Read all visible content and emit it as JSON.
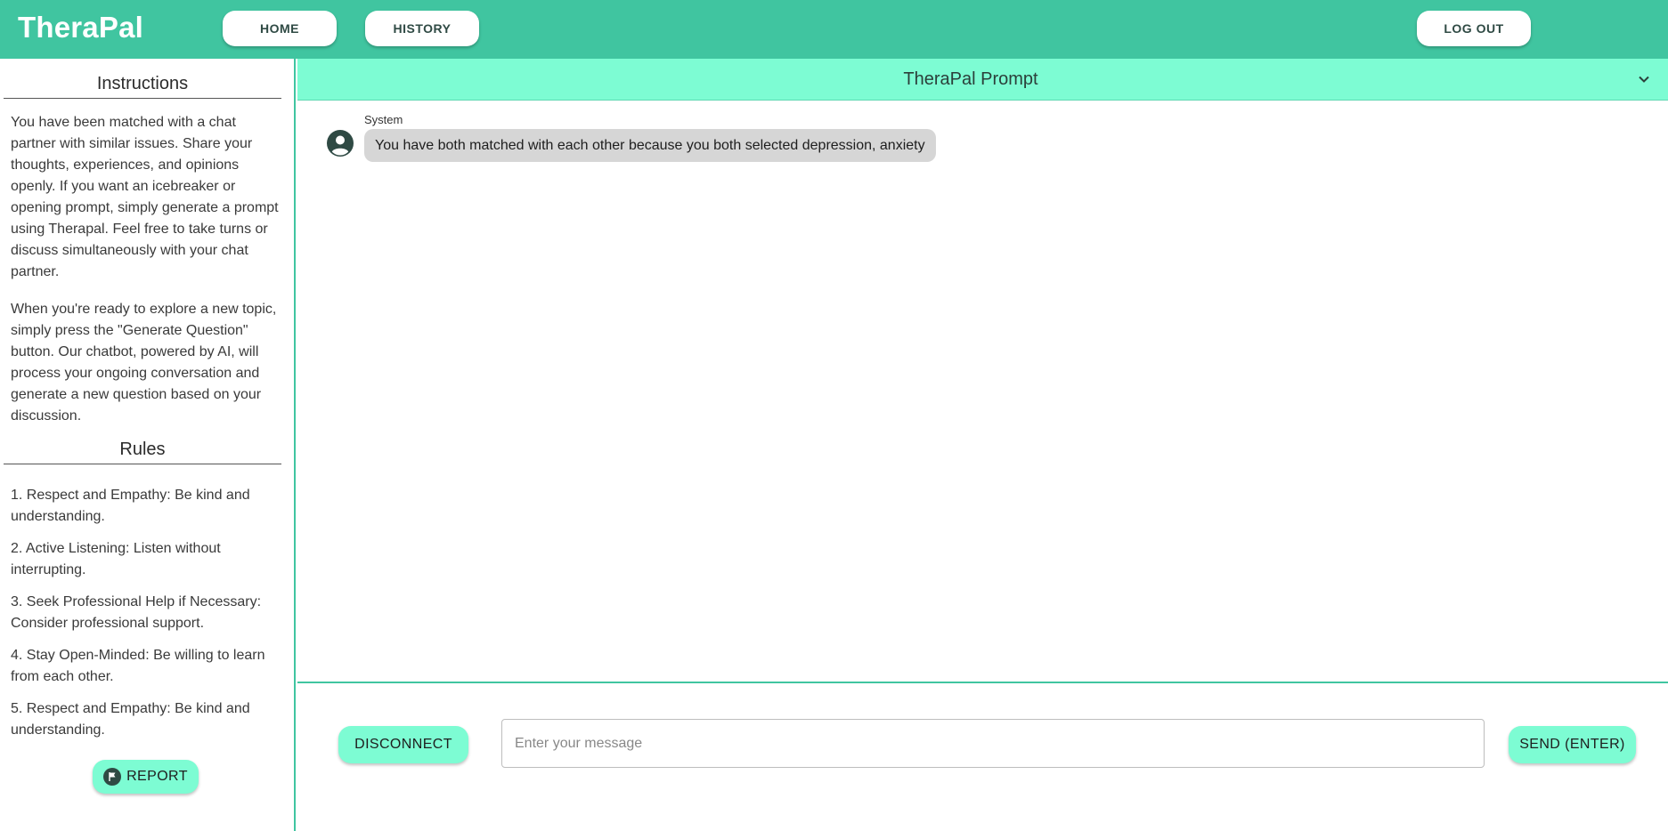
{
  "header": {
    "brand": "TheraPal",
    "nav": {
      "home": "HOME",
      "history": "HISTORY",
      "logout": "LOG OUT"
    }
  },
  "sidebar": {
    "instructions_title": "Instructions",
    "instructions_paragraphs": [
      "You have been matched with a chat partner with similar issues. Share your thoughts, experiences, and opinions openly. If you want an icebreaker or opening prompt, simply generate a prompt using Therapal. Feel free to take turns or discuss simultaneously with your chat partner.",
      "When you're ready to explore a new topic, simply press the \"Generate Question\" button. Our chatbot, powered by AI, will process your ongoing conversation and generate a new question based on your discussion."
    ],
    "rules_title": "Rules",
    "rules": [
      "1. Respect and Empathy: Be kind and understanding.",
      "2. Active Listening: Listen without interrupting.",
      "3. Seek Professional Help if Necessary: Consider professional support.",
      "4. Stay Open-Minded: Be willing to learn from each other.",
      "5. Respect and Empathy: Be kind and understanding."
    ],
    "report_label": "REPORT",
    "report_icon": "flag-icon"
  },
  "chat": {
    "prompt_title": "TheraPal Prompt",
    "prompt_toggle_icon": "chevron-down-icon",
    "messages": [
      {
        "sender": "System",
        "avatar_icon": "account-circle-icon",
        "text": "You have both matched with each other because you both selected depression, anxiety"
      }
    ]
  },
  "composer": {
    "disconnect_label": "DISCONNECT",
    "input_value": "",
    "input_placeholder": "Enter your message",
    "send_label": "SEND (ENTER)"
  },
  "colors": {
    "header_bg": "#40c5a0",
    "accent_light": "#7dfcd3",
    "bubble_bg": "#d6d6d6",
    "icon_dark": "#2f4a44"
  }
}
